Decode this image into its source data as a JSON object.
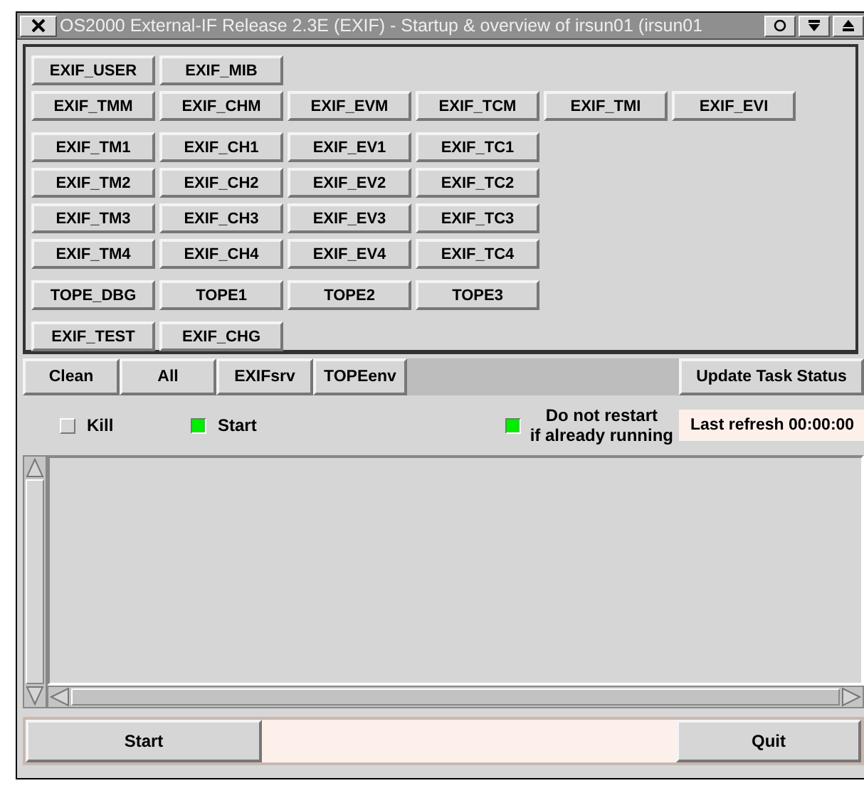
{
  "window": {
    "title": "OS2000 External-IF Release 2.3E (EXIF) - Startup & overview of irsun01 (irsun01"
  },
  "task_groups": [
    {
      "rows": [
        [
          "EXIF_USER",
          "EXIF_MIB"
        ],
        [
          "EXIF_TMM",
          "EXIF_CHM",
          "EXIF_EVM",
          "EXIF_TCM",
          "EXIF_TMI",
          "EXIF_EVI"
        ]
      ]
    },
    {
      "rows": [
        [
          "EXIF_TM1",
          "EXIF_CH1",
          "EXIF_EV1",
          "EXIF_TC1"
        ],
        [
          "EXIF_TM2",
          "EXIF_CH2",
          "EXIF_EV2",
          "EXIF_TC2"
        ],
        [
          "EXIF_TM3",
          "EXIF_CH3",
          "EXIF_EV3",
          "EXIF_TC3"
        ],
        [
          "EXIF_TM4",
          "EXIF_CH4",
          "EXIF_EV4",
          "EXIF_TC4"
        ]
      ]
    },
    {
      "rows": [
        [
          "TOPE_DBG",
          "TOPE1",
          "TOPE2",
          "TOPE3"
        ]
      ]
    },
    {
      "rows": [
        [
          "EXIF_TEST",
          "EXIF_CHG"
        ]
      ]
    }
  ],
  "toolbar": {
    "buttons": [
      "Clean",
      "All",
      "EXIFsrv",
      "TOPEenv"
    ],
    "update_button": "Update Task Status"
  },
  "options": [
    {
      "label": "Kill",
      "checked": false
    },
    {
      "label": "Start",
      "checked": true
    }
  ],
  "no_restart": {
    "label": [
      "Do not restart",
      "if already running"
    ],
    "checked": true
  },
  "last_refresh": "Last refresh 00:00:00",
  "footer": {
    "start_button": "Start",
    "quit_button": "Quit"
  }
}
